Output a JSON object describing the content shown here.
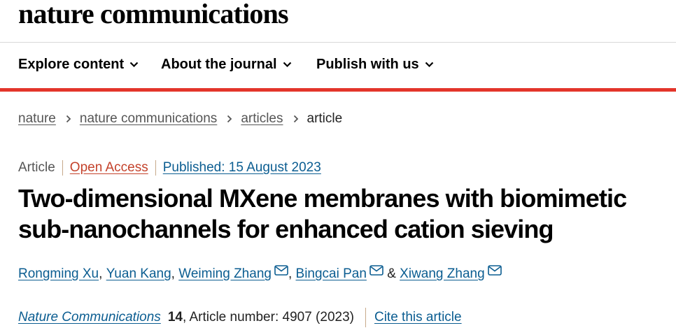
{
  "header": {
    "logo_text": "nature communications"
  },
  "nav": {
    "items": [
      {
        "label": "Explore content",
        "icon": "chevron-down-icon"
      },
      {
        "label": "About the journal",
        "icon": "chevron-down-icon"
      },
      {
        "label": "Publish with us",
        "icon": "chevron-down-icon"
      }
    ],
    "accent_color": "#e3352b"
  },
  "breadcrumb": {
    "items": [
      "nature",
      "nature communications",
      "articles"
    ],
    "current": "article",
    "separator_icon": "chevron-right-icon"
  },
  "article": {
    "type": "Article",
    "open_access": "Open Access",
    "published": "Published: 15 August 2023",
    "title": "Two-dimensional MXene membranes with biomimetic sub-nanochannels for enhanced cation sieving",
    "authors": [
      {
        "name": "Rongming Xu",
        "sep": ",",
        "email": false
      },
      {
        "name": "Yuan Kang",
        "sep": ",",
        "email": false
      },
      {
        "name": "Weiming Zhang",
        "sep": ",",
        "email": true
      },
      {
        "name": "Bingcai Pan",
        "sep": "&",
        "email": true
      },
      {
        "name": "Xiwang Zhang",
        "sep": "",
        "email": true
      }
    ],
    "email_icon": "envelope-icon",
    "citation": {
      "journal": "Nature Communications",
      "volume": "14",
      "article_number": ", Article number: 4907 (2023)",
      "cite_link": "Cite this article"
    }
  }
}
